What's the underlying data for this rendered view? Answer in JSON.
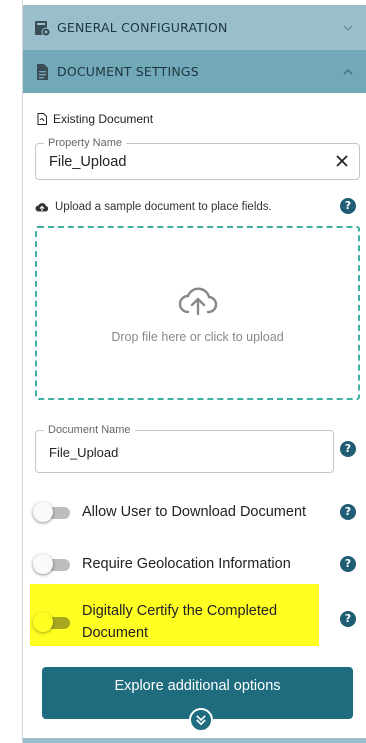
{
  "sections": {
    "general": {
      "title": "GENERAL CONFIGURATION",
      "icon": "gear-page-icon",
      "state": "collapsed"
    },
    "document": {
      "title": "DOCUMENT SETTINGS",
      "icon": "document-icon",
      "state": "expanded"
    }
  },
  "document_settings": {
    "existing_document_label": "Existing Document",
    "property_name": {
      "label": "Property Name",
      "value": "File_Upload"
    },
    "upload_label": "Upload a sample document to place fields.",
    "dropzone_text": "Drop file here or click to upload",
    "document_name": {
      "label": "Document Name",
      "value": "File_Upload"
    },
    "toggles": [
      {
        "label": "Allow User to Download Document",
        "checked": false
      },
      {
        "label": "Require Geolocation Information",
        "checked": false
      },
      {
        "label": "Digitally Certify the Completed Document",
        "checked": false,
        "highlighted": true
      }
    ],
    "help_symbol": "?",
    "explore_button": "Explore additional options"
  },
  "colors": {
    "general_header": "#98bfcb",
    "document_header": "#72a9b8",
    "dropzone_border": "#3fb0a2",
    "primary_button": "#1e6c7e",
    "help_icon": "#1f5d74",
    "highlight": "#ffff22"
  }
}
